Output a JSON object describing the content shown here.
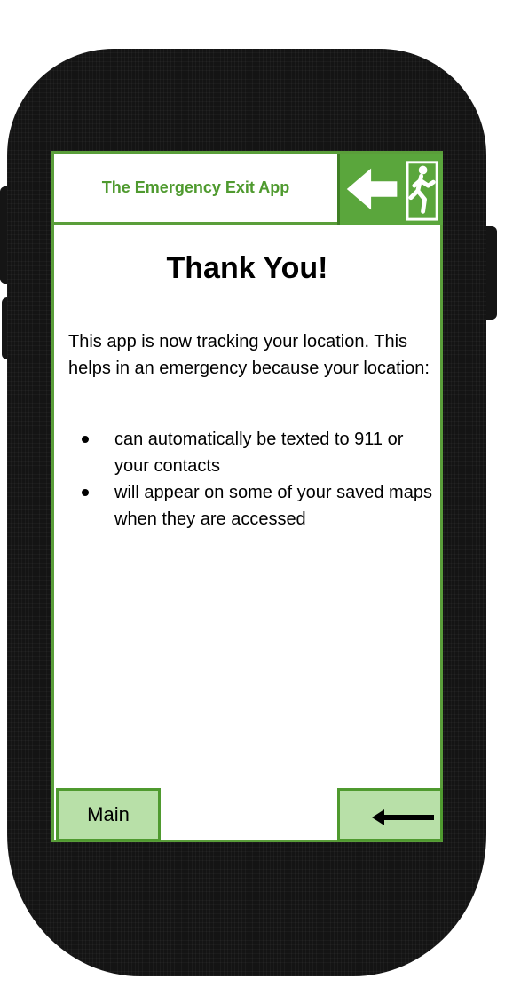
{
  "app": {
    "title": "The Emergency Exit App"
  },
  "content": {
    "heading": "Thank You!",
    "intro": "This app is now tracking your location. This helps in an emergency because your location:",
    "bullets": [
      "can automatically be texted to 911 or your contacts",
      "will appear on some of your saved maps when they are accessed"
    ]
  },
  "footer": {
    "main_label": "Main",
    "back_icon": "left-arrow-icon"
  },
  "colors": {
    "accent_green": "#5aa63c",
    "title_green": "#4f9a2f",
    "button_fill": "#b8e0a8",
    "phone_body": "#141414"
  },
  "icons": {
    "logo": "emergency-exit-sign-icon"
  }
}
